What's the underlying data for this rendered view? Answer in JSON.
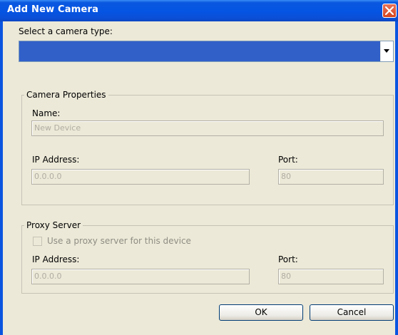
{
  "window": {
    "title": "Add New Camera"
  },
  "camera_type": {
    "label": "Select a camera type:",
    "selected_value": ""
  },
  "camera_properties": {
    "legend": "Camera Properties",
    "name_label": "Name:",
    "name_value": "New Device",
    "ip_label": "IP Address:",
    "ip_value": "0.0.0.0",
    "port_label": "Port:",
    "port_value": "80"
  },
  "proxy_server": {
    "legend": "Proxy Server",
    "use_proxy_label": "Use a proxy server for this device",
    "use_proxy_checked": false,
    "ip_label": "IP Address:",
    "ip_value": "0.0.0.0",
    "port_label": "Port:",
    "port_value": "80"
  },
  "buttons": {
    "ok": "OK",
    "cancel": "Cancel"
  },
  "colors": {
    "titlebar": "#0554e3",
    "dialog_bg": "#ece9d8",
    "selection": "#3160c9",
    "close": "#d4451f"
  }
}
